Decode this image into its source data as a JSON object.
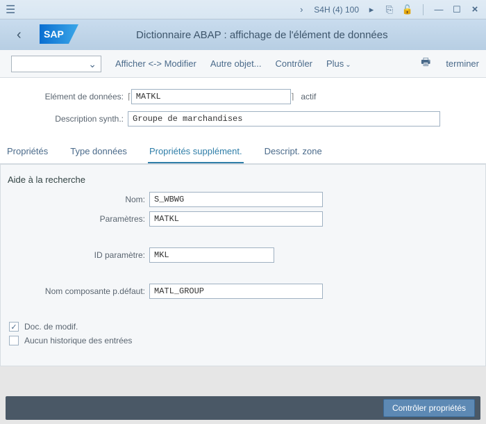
{
  "titlebar": {
    "system": "S4H (4) 100"
  },
  "header": {
    "title": "Dictionnaire ABAP : affichage de l'élément de données"
  },
  "toolbar": {
    "display_modify": "Afficher <-> Modifier",
    "other_object": "Autre objet...",
    "control": "Contrôler",
    "more": "Plus",
    "terminate": "terminer"
  },
  "form": {
    "element_label": "Elément de données:",
    "element_value": "MATKL",
    "element_status": "actif",
    "desc_label": "Description synth.:",
    "desc_value": "Groupe de marchandises"
  },
  "tabs": {
    "t1": "Propriétés",
    "t2": "Type données",
    "t3": "Propriétés supplément.",
    "t4": "Descript. zone"
  },
  "section": {
    "heading": "Aide à la recherche",
    "name_label": "Nom:",
    "name_value": "S_WBWG",
    "param_label": "Paramètres:",
    "param_value": "MATKL",
    "idparam_label": "ID paramètre:",
    "idparam_value": "MKL",
    "comp_label": "Nom composante p.défaut:",
    "comp_value": "MATL_GROUP"
  },
  "checks": {
    "doc_modif": "Doc. de modif.",
    "no_history": "Aucun historique des entrées"
  },
  "footer": {
    "control_props": "Contrôler propriétés"
  }
}
